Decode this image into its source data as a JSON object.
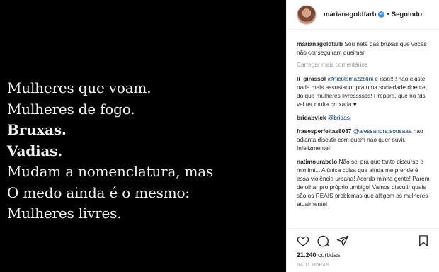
{
  "post_image": {
    "lines": [
      {
        "text": "Mulheres que voam.",
        "bold": false
      },
      {
        "text": "Mulheres de fogo.",
        "bold": false
      },
      {
        "text": "Bruxas.",
        "bold": true
      },
      {
        "text": "Vadias.",
        "bold": true
      },
      {
        "text": "Mudam a nomenclatura, mas",
        "bold": false
      },
      {
        "text": "O medo ainda é o mesmo:",
        "bold": false
      },
      {
        "text": "Mulheres livres.",
        "bold": false
      }
    ]
  },
  "header": {
    "username": "marianagoldfarb",
    "verified_icon": "✔",
    "separator": "•",
    "follow_label": "Seguindo"
  },
  "caption": {
    "user": "marianagoldfarb",
    "text": "Sou neta das bruxas que vocês não conseguiram queimar"
  },
  "load_more": "Carregar mais comentários",
  "comments": [
    {
      "user": "li_girassol",
      "mention": "@nicolemazzolini",
      "text": "é isso!!!! não existe nada mais assustador pra uma sociedade doente, do que mulheres livressssss! Prepara, que no fds vai ter muita bruxaria",
      "heart": "♥"
    },
    {
      "user": "bridabvick",
      "mention": "@bridasj",
      "text": "",
      "heart": ""
    },
    {
      "user": "frasesperfeitas8087",
      "mention": "@alessandra.sousaaa",
      "text": "nao adianta discutir com quem nao quer ouvir. Infelizmente!",
      "heart": ""
    },
    {
      "user": "natimourabelo",
      "mention": "",
      "text": "Não sei pra que tanto discurso e mimimi... A única coisa que ainda me prende é essa violência urbana! Acorda minha gente! Parem de olhar pro próprio umbigo! Vamos discutir quais são os REAIS problemas que afligem as mulheres atualmente!",
      "heart": ""
    }
  ],
  "actions": {
    "icons": [
      "heart-icon",
      "comment-icon",
      "share-icon",
      "bookmark-icon"
    ]
  },
  "likes": {
    "count": "21.240",
    "label": "curtidas"
  },
  "timestamp": "HÁ 11 HORAS"
}
